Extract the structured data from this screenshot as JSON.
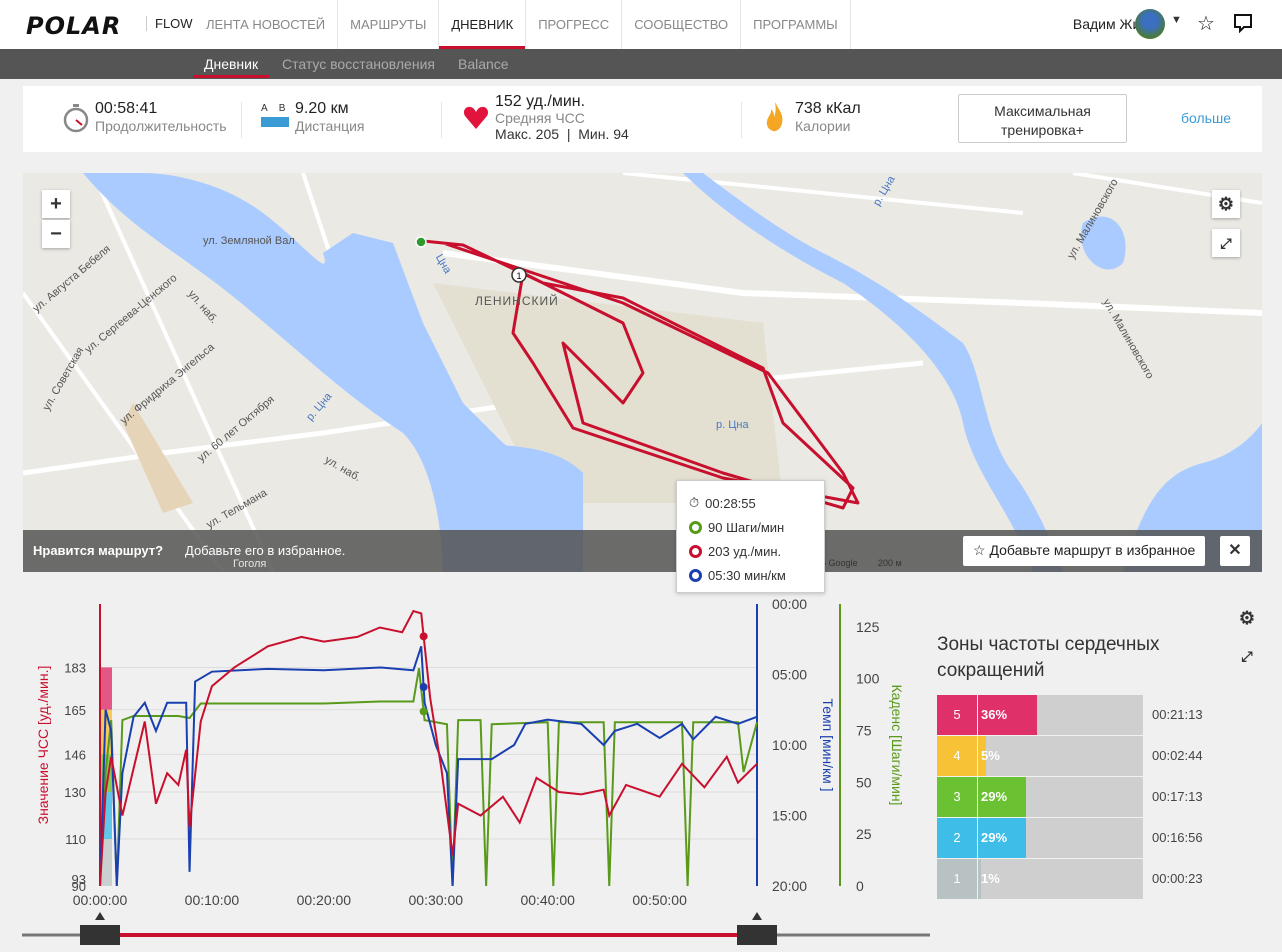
{
  "nav": {
    "logo": "POLAR",
    "product": "FLOW",
    "items": [
      "ЛЕНТА НОВОСТЕЙ",
      "МАРШРУТЫ",
      "ДНЕВНИК",
      "ПРОГРЕСС",
      "СООБЩЕСТВО",
      "ПРОГРАММЫ"
    ],
    "active": "ДНЕВНИК",
    "user": "Вадим Жилин"
  },
  "subnav": {
    "items": [
      "Дневник",
      "Статус восстановления",
      "Balance"
    ],
    "active": "Дневник"
  },
  "stats": {
    "duration": {
      "value": "00:58:41",
      "label": "Продолжительность"
    },
    "distance": {
      "value": "9.20 км",
      "label": "Дистанция",
      "a": "A",
      "b": "B"
    },
    "hr": {
      "value": "152 уд./мин.",
      "label": "Средняя ЧСС",
      "max": "Макс. 205",
      "min": "Мин. 94",
      "sep": "|"
    },
    "calories": {
      "value": "738 кКал",
      "label": "Калории"
    },
    "training_button": "Максимальная тренировка+",
    "more": "больше"
  },
  "map": {
    "labels": [
      "ул. Земляной Вал",
      "ЛЕНИНСКИЙ",
      "р. Цна",
      "р. Цна",
      "Цна",
      "р. Цна",
      "ул. Малиновского",
      "ул. Малиновского",
      "ул. Советская",
      "ул. Фридриха Энгельса",
      "ул. 60 лет Октября",
      "ул. Августа Бебеля",
      "ул. Сергеева-Ценского",
      "ул. Тельмана",
      "ул. наб.",
      "ул. наб.",
      "Гоголя"
    ],
    "zoom_in": "+",
    "zoom_out": "−",
    "fav_prompt_bold": "Нравится маршрут?",
    "fav_prompt": "Добавьте его в избранное.",
    "fav_button": "Добавьте маршрут в избранное",
    "attribution": "6 Google",
    "scale": "200 м",
    "lap_marker": "1",
    "route_color": "#c8102e"
  },
  "tooltip": {
    "time": "00:28:55",
    "cadence": "90 Шаги/мин",
    "hr": "203 уд./мин.",
    "pace": "05:30 мин/км"
  },
  "chart_data": {
    "type": "line",
    "x_ticks": [
      "00:00:00",
      "00:10:00",
      "00:20:00",
      "00:30:00",
      "00:40:00",
      "00:50:00"
    ],
    "xlim_min": [
      0,
      58.7
    ],
    "axes": {
      "hr": {
        "label": "Значение ЧСС [уд./мин.]",
        "ticks": [
          90,
          93,
          110,
          130,
          146,
          165,
          183
        ],
        "range": [
          90,
          210
        ],
        "color": "#c8102e"
      },
      "pace": {
        "label": "Темп [мин/км ]",
        "ticks": [
          "00:00",
          "05:00",
          "10:00",
          "15:00",
          "20:00"
        ],
        "range": [
          0,
          20
        ],
        "color": "#1a3fb0"
      },
      "cadence": {
        "label": "Каденс [Шаги/мин]",
        "ticks": [
          0,
          25,
          50,
          75,
          100,
          125
        ],
        "range": [
          0,
          136
        ],
        "color": "#5a9a1a"
      }
    },
    "hr_zone_bands": [
      {
        "from": 165,
        "to": 183,
        "color": "#e0306a"
      },
      {
        "from": 146,
        "to": 165,
        "color": "#f7c235"
      },
      {
        "from": 130,
        "to": 146,
        "color": "#6ac232"
      },
      {
        "from": 110,
        "to": 130,
        "color": "#3dbde8"
      },
      {
        "from": 90,
        "to": 110,
        "color": "#c0c8c8"
      }
    ],
    "series": [
      {
        "axis": "hr",
        "points": [
          [
            0,
            90
          ],
          [
            0.5,
            130
          ],
          [
            1,
            145
          ],
          [
            2,
            120
          ],
          [
            3,
            140
          ],
          [
            4,
            160
          ],
          [
            5,
            125
          ],
          [
            6,
            138
          ],
          [
            7,
            133
          ],
          [
            7.7,
            148
          ],
          [
            8,
            115
          ],
          [
            9,
            160
          ],
          [
            10,
            175
          ],
          [
            12,
            183
          ],
          [
            15,
            192
          ],
          [
            18,
            196
          ],
          [
            20,
            194
          ],
          [
            23,
            196
          ],
          [
            25,
            200
          ],
          [
            27,
            198
          ],
          [
            28,
            207
          ],
          [
            28.7,
            206
          ],
          [
            29.5,
            170
          ],
          [
            30.5,
            140
          ],
          [
            31.5,
            103
          ],
          [
            32,
            125
          ],
          [
            34,
            120
          ],
          [
            36,
            128
          ],
          [
            37.5,
            117
          ],
          [
            39,
            136
          ],
          [
            41,
            130
          ],
          [
            43,
            129
          ],
          [
            45,
            131
          ],
          [
            45.5,
            120
          ],
          [
            47,
            133
          ],
          [
            50,
            128
          ],
          [
            52,
            142
          ],
          [
            54,
            132
          ],
          [
            56,
            145
          ],
          [
            57,
            134
          ],
          [
            58.7,
            142
          ]
        ]
      },
      {
        "axis": "pace",
        "points": [
          [
            0,
            20
          ],
          [
            0.5,
            7.5
          ],
          [
            1,
            9
          ],
          [
            1.5,
            20
          ],
          [
            2,
            12
          ],
          [
            3,
            8
          ],
          [
            4,
            7
          ],
          [
            5,
            9
          ],
          [
            6,
            7
          ],
          [
            7.7,
            7
          ],
          [
            8,
            19
          ],
          [
            8.5,
            5.5
          ],
          [
            10,
            4.8
          ],
          [
            15,
            4.6
          ],
          [
            20,
            4.7
          ],
          [
            25,
            4.5
          ],
          [
            28,
            4.7
          ],
          [
            28.7,
            3
          ],
          [
            29,
            7
          ],
          [
            30,
            10
          ],
          [
            31,
            12
          ],
          [
            31.5,
            20
          ],
          [
            32,
            11
          ],
          [
            35,
            11
          ],
          [
            37,
            10
          ],
          [
            38,
            8.5
          ],
          [
            40,
            8.2
          ],
          [
            43,
            8.5
          ],
          [
            45,
            10
          ],
          [
            46,
            9
          ],
          [
            48,
            8.5
          ],
          [
            50,
            9.5
          ],
          [
            52,
            8.5
          ],
          [
            53,
            9.6
          ],
          [
            55,
            8
          ],
          [
            57,
            8.5
          ],
          [
            58.7,
            8
          ]
        ]
      },
      {
        "axis": "cadence",
        "points": [
          [
            0,
            0
          ],
          [
            0.5,
            55
          ],
          [
            1,
            80
          ],
          [
            1.5,
            0
          ],
          [
            2,
            80
          ],
          [
            3,
            82
          ],
          [
            5,
            82
          ],
          [
            7,
            82
          ],
          [
            8,
            81
          ],
          [
            9,
            88
          ],
          [
            15,
            88
          ],
          [
            20,
            88
          ],
          [
            25,
            89
          ],
          [
            28,
            89
          ],
          [
            28.5,
            105
          ],
          [
            29,
            80
          ],
          [
            31,
            78
          ],
          [
            31.5,
            0
          ],
          [
            32,
            80
          ],
          [
            34,
            80
          ],
          [
            34.5,
            0
          ],
          [
            35,
            78
          ],
          [
            40,
            79
          ],
          [
            40.5,
            0
          ],
          [
            41,
            79
          ],
          [
            45,
            79
          ],
          [
            45.5,
            0
          ],
          [
            46,
            79
          ],
          [
            52,
            79
          ],
          [
            52.5,
            0
          ],
          [
            53,
            79
          ],
          [
            57,
            79
          ],
          [
            57.5,
            55
          ],
          [
            58.7,
            79
          ]
        ]
      }
    ],
    "cursor_time": "00:28:55"
  },
  "zones": {
    "title": "Зоны частоты сердечных сокращений",
    "rows": [
      {
        "zone": "5",
        "percent": "36%",
        "fraction": 0.36,
        "time": "00:21:13",
        "color": "#e0306a"
      },
      {
        "zone": "4",
        "percent": "5%",
        "fraction": 0.05,
        "time": "00:02:44",
        "color": "#f7c235"
      },
      {
        "zone": "3",
        "percent": "29%",
        "fraction": 0.29,
        "time": "00:17:13",
        "color": "#6ac232"
      },
      {
        "zone": "2",
        "percent": "29%",
        "fraction": 0.29,
        "time": "00:16:56",
        "color": "#3dbde8"
      },
      {
        "zone": "1",
        "percent": "1%",
        "fraction": 0.01,
        "time": "00:00:23",
        "color": "#b8c2c2"
      }
    ]
  }
}
